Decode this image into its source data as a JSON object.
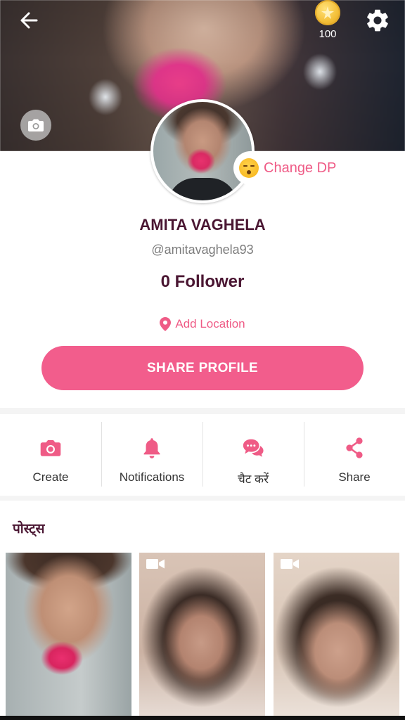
{
  "header": {
    "coin_count": "100",
    "icons": {
      "back": "arrow-left-icon",
      "coin": "gold-coin-icon",
      "settings": "gear-icon",
      "cover_camera": "camera-icon"
    }
  },
  "profile": {
    "change_dp_label": "Change DP",
    "name": "AMITA VAGHELA",
    "username": "@amitavaghela93",
    "followers": "0 Follower",
    "add_location_label": "Add Location",
    "share_profile_label": "SHARE PROFILE"
  },
  "actions": [
    {
      "label": "Create",
      "icon": "camera-icon"
    },
    {
      "label": "Notifications",
      "icon": "bell-icon"
    },
    {
      "label": "चैट करें",
      "icon": "chat-bubbles-icon"
    },
    {
      "label": "Share",
      "icon": "share-icon"
    }
  ],
  "posts": {
    "title": "पोस्ट्स",
    "items": [
      {
        "type": "photo"
      },
      {
        "type": "video"
      },
      {
        "type": "video"
      }
    ]
  },
  "colors": {
    "accent": "#f25d8c",
    "name_text": "#4a1632",
    "coin": "#f4c03a"
  }
}
